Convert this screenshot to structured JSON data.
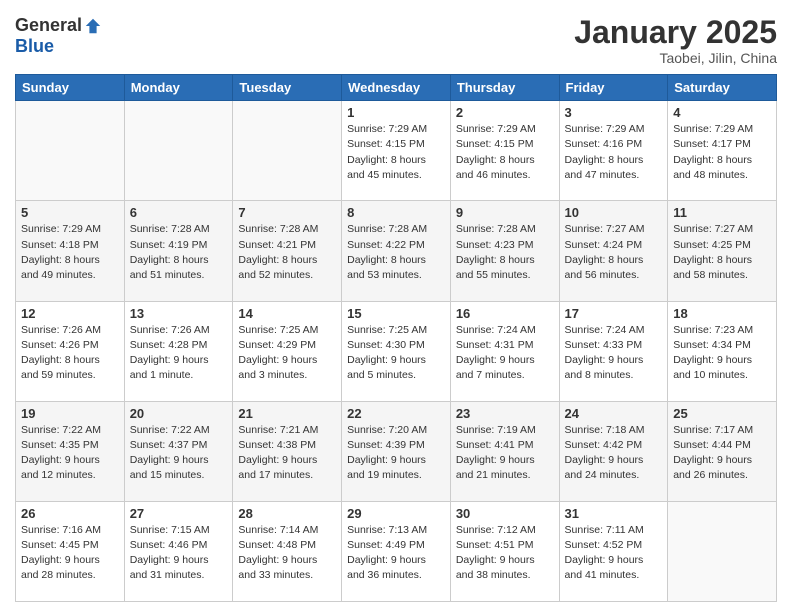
{
  "header": {
    "logo_general": "General",
    "logo_blue": "Blue",
    "month_title": "January 2025",
    "location": "Taobei, Jilin, China"
  },
  "weekdays": [
    "Sunday",
    "Monday",
    "Tuesday",
    "Wednesday",
    "Thursday",
    "Friday",
    "Saturday"
  ],
  "weeks": [
    [
      {
        "day": "",
        "sunrise": "",
        "sunset": "",
        "daylight": ""
      },
      {
        "day": "",
        "sunrise": "",
        "sunset": "",
        "daylight": ""
      },
      {
        "day": "",
        "sunrise": "",
        "sunset": "",
        "daylight": ""
      },
      {
        "day": "1",
        "sunrise": "Sunrise: 7:29 AM",
        "sunset": "Sunset: 4:15 PM",
        "daylight": "Daylight: 8 hours and 45 minutes."
      },
      {
        "day": "2",
        "sunrise": "Sunrise: 7:29 AM",
        "sunset": "Sunset: 4:15 PM",
        "daylight": "Daylight: 8 hours and 46 minutes."
      },
      {
        "day": "3",
        "sunrise": "Sunrise: 7:29 AM",
        "sunset": "Sunset: 4:16 PM",
        "daylight": "Daylight: 8 hours and 47 minutes."
      },
      {
        "day": "4",
        "sunrise": "Sunrise: 7:29 AM",
        "sunset": "Sunset: 4:17 PM",
        "daylight": "Daylight: 8 hours and 48 minutes."
      }
    ],
    [
      {
        "day": "5",
        "sunrise": "Sunrise: 7:29 AM",
        "sunset": "Sunset: 4:18 PM",
        "daylight": "Daylight: 8 hours and 49 minutes."
      },
      {
        "day": "6",
        "sunrise": "Sunrise: 7:28 AM",
        "sunset": "Sunset: 4:19 PM",
        "daylight": "Daylight: 8 hours and 51 minutes."
      },
      {
        "day": "7",
        "sunrise": "Sunrise: 7:28 AM",
        "sunset": "Sunset: 4:21 PM",
        "daylight": "Daylight: 8 hours and 52 minutes."
      },
      {
        "day": "8",
        "sunrise": "Sunrise: 7:28 AM",
        "sunset": "Sunset: 4:22 PM",
        "daylight": "Daylight: 8 hours and 53 minutes."
      },
      {
        "day": "9",
        "sunrise": "Sunrise: 7:28 AM",
        "sunset": "Sunset: 4:23 PM",
        "daylight": "Daylight: 8 hours and 55 minutes."
      },
      {
        "day": "10",
        "sunrise": "Sunrise: 7:27 AM",
        "sunset": "Sunset: 4:24 PM",
        "daylight": "Daylight: 8 hours and 56 minutes."
      },
      {
        "day": "11",
        "sunrise": "Sunrise: 7:27 AM",
        "sunset": "Sunset: 4:25 PM",
        "daylight": "Daylight: 8 hours and 58 minutes."
      }
    ],
    [
      {
        "day": "12",
        "sunrise": "Sunrise: 7:26 AM",
        "sunset": "Sunset: 4:26 PM",
        "daylight": "Daylight: 8 hours and 59 minutes."
      },
      {
        "day": "13",
        "sunrise": "Sunrise: 7:26 AM",
        "sunset": "Sunset: 4:28 PM",
        "daylight": "Daylight: 9 hours and 1 minute."
      },
      {
        "day": "14",
        "sunrise": "Sunrise: 7:25 AM",
        "sunset": "Sunset: 4:29 PM",
        "daylight": "Daylight: 9 hours and 3 minutes."
      },
      {
        "day": "15",
        "sunrise": "Sunrise: 7:25 AM",
        "sunset": "Sunset: 4:30 PM",
        "daylight": "Daylight: 9 hours and 5 minutes."
      },
      {
        "day": "16",
        "sunrise": "Sunrise: 7:24 AM",
        "sunset": "Sunset: 4:31 PM",
        "daylight": "Daylight: 9 hours and 7 minutes."
      },
      {
        "day": "17",
        "sunrise": "Sunrise: 7:24 AM",
        "sunset": "Sunset: 4:33 PM",
        "daylight": "Daylight: 9 hours and 8 minutes."
      },
      {
        "day": "18",
        "sunrise": "Sunrise: 7:23 AM",
        "sunset": "Sunset: 4:34 PM",
        "daylight": "Daylight: 9 hours and 10 minutes."
      }
    ],
    [
      {
        "day": "19",
        "sunrise": "Sunrise: 7:22 AM",
        "sunset": "Sunset: 4:35 PM",
        "daylight": "Daylight: 9 hours and 12 minutes."
      },
      {
        "day": "20",
        "sunrise": "Sunrise: 7:22 AM",
        "sunset": "Sunset: 4:37 PM",
        "daylight": "Daylight: 9 hours and 15 minutes."
      },
      {
        "day": "21",
        "sunrise": "Sunrise: 7:21 AM",
        "sunset": "Sunset: 4:38 PM",
        "daylight": "Daylight: 9 hours and 17 minutes."
      },
      {
        "day": "22",
        "sunrise": "Sunrise: 7:20 AM",
        "sunset": "Sunset: 4:39 PM",
        "daylight": "Daylight: 9 hours and 19 minutes."
      },
      {
        "day": "23",
        "sunrise": "Sunrise: 7:19 AM",
        "sunset": "Sunset: 4:41 PM",
        "daylight": "Daylight: 9 hours and 21 minutes."
      },
      {
        "day": "24",
        "sunrise": "Sunrise: 7:18 AM",
        "sunset": "Sunset: 4:42 PM",
        "daylight": "Daylight: 9 hours and 24 minutes."
      },
      {
        "day": "25",
        "sunrise": "Sunrise: 7:17 AM",
        "sunset": "Sunset: 4:44 PM",
        "daylight": "Daylight: 9 hours and 26 minutes."
      }
    ],
    [
      {
        "day": "26",
        "sunrise": "Sunrise: 7:16 AM",
        "sunset": "Sunset: 4:45 PM",
        "daylight": "Daylight: 9 hours and 28 minutes."
      },
      {
        "day": "27",
        "sunrise": "Sunrise: 7:15 AM",
        "sunset": "Sunset: 4:46 PM",
        "daylight": "Daylight: 9 hours and 31 minutes."
      },
      {
        "day": "28",
        "sunrise": "Sunrise: 7:14 AM",
        "sunset": "Sunset: 4:48 PM",
        "daylight": "Daylight: 9 hours and 33 minutes."
      },
      {
        "day": "29",
        "sunrise": "Sunrise: 7:13 AM",
        "sunset": "Sunset: 4:49 PM",
        "daylight": "Daylight: 9 hours and 36 minutes."
      },
      {
        "day": "30",
        "sunrise": "Sunrise: 7:12 AM",
        "sunset": "Sunset: 4:51 PM",
        "daylight": "Daylight: 9 hours and 38 minutes."
      },
      {
        "day": "31",
        "sunrise": "Sunrise: 7:11 AM",
        "sunset": "Sunset: 4:52 PM",
        "daylight": "Daylight: 9 hours and 41 minutes."
      },
      {
        "day": "",
        "sunrise": "",
        "sunset": "",
        "daylight": ""
      }
    ]
  ]
}
